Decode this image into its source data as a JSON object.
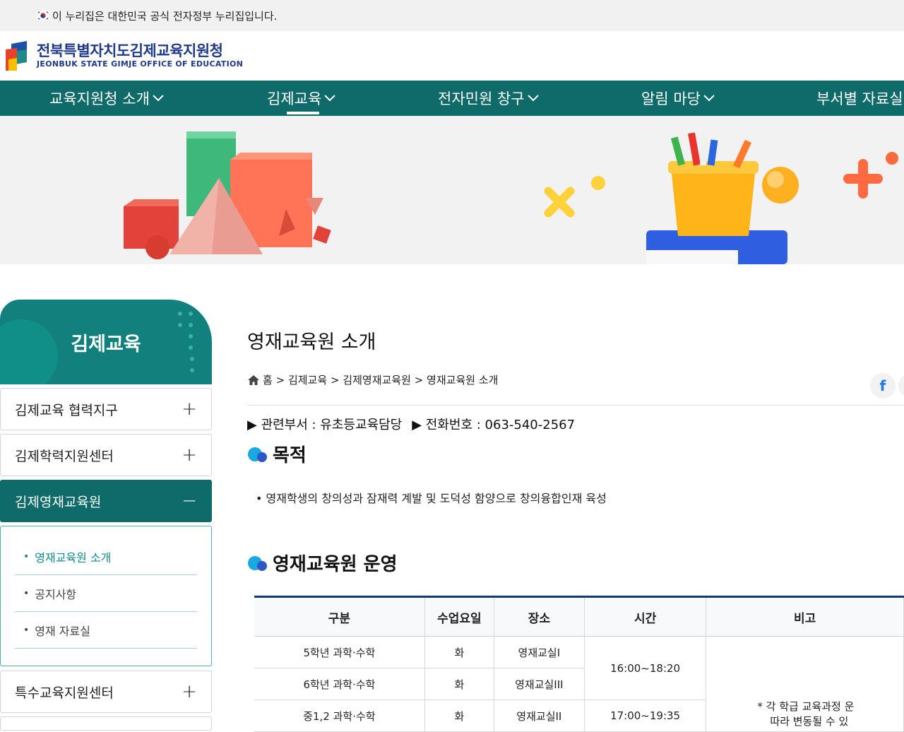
{
  "gov_banner": {
    "text": "이 누리집은 대한민국 공식 전자정부 누리집입니다."
  },
  "logo": {
    "name_ko": "전북특별자치도김제교육지원청",
    "name_en": "JEONBUK STATE GIMJE OFFICE OF EDUCATION"
  },
  "nav": {
    "items": [
      {
        "label": "교육지원청 소개"
      },
      {
        "label": "김제교육"
      },
      {
        "label": "전자민원 창구"
      },
      {
        "label": "알림 마당"
      },
      {
        "label": "부서별 자료실"
      }
    ]
  },
  "sidebar": {
    "title": "김제교육",
    "items": [
      {
        "label": "김제교육 협력지구"
      },
      {
        "label": "김제학력지원센터"
      },
      {
        "label": "김제영재교육원"
      },
      {
        "label": "특수교육지원센터"
      }
    ],
    "sub_items": [
      {
        "label": "영재교육원 소개"
      },
      {
        "label": "공지사항"
      },
      {
        "label": "영재 자료실"
      }
    ],
    "expand_symbol": "+",
    "collapse_symbol": "−",
    "bullet": "•"
  },
  "main": {
    "page_title": "영재교육원 소개",
    "breadcrumb": [
      "홈",
      ">",
      "김제교육",
      ">",
      "김제영재교육원",
      ">",
      "영재교육원 소개"
    ],
    "dept": "▶ 관련부서 : 유초등교육담당",
    "phone": "▶ 전화번호 : 063-540-2567",
    "section1_title": "목적",
    "purpose": "• 영재학생의 창의성과 잠재력 계발 및 도덕성 함양으로 창의융합인재 육성",
    "section2_title": "영재교육원 운영",
    "facebook_letter": "f"
  },
  "table": {
    "headers": [
      "구분",
      "수업요일",
      "장소",
      "시간",
      "비고"
    ],
    "rows": [
      [
        "5학년 과학·수학",
        "화",
        "영재교실I"
      ],
      [
        "6학년 과학·수학",
        "화",
        "영재교실III"
      ],
      [
        "중1,2 과학·수학",
        "화",
        "영재교실II"
      ]
    ],
    "time_1": "16:00~18:20",
    "time_2": "17:00~19:35",
    "note_line1": "* 각 학급 교육과정 운",
    "note_line2": "따라 변동될 수 있"
  },
  "colors": {
    "teal": "#0f6a6a",
    "teal_light": "#12807d",
    "navy": "#1f3a8a"
  }
}
